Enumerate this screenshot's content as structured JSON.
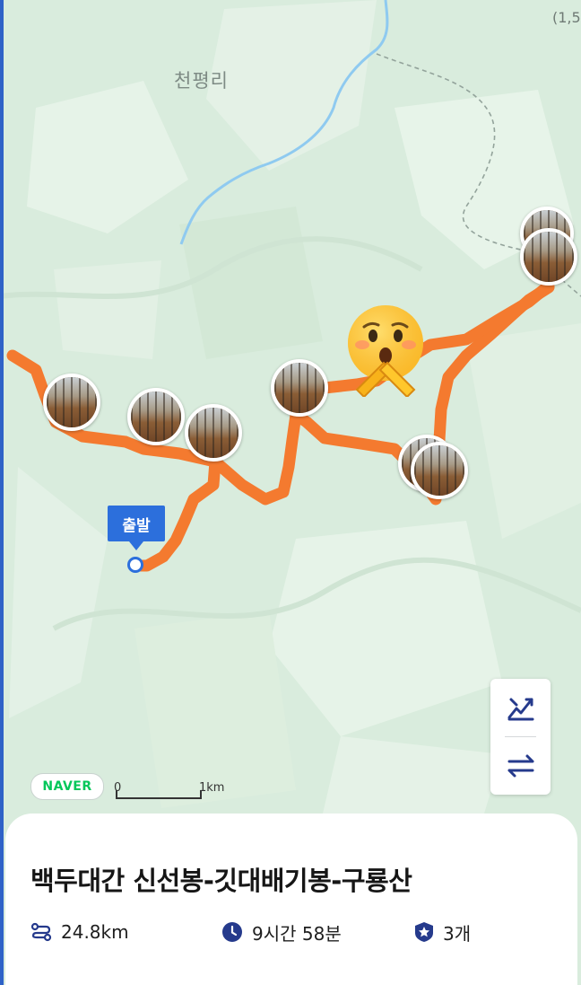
{
  "map": {
    "place_label": "천평리",
    "corner_label": "(1,5",
    "start_marker": {
      "label": "출발"
    },
    "provider_logo": "NAVER",
    "scale": {
      "zero": "0",
      "distance": "1km"
    },
    "route_color": "#f47a2f",
    "photo_markers": [
      {
        "name": "photo-marker-1"
      },
      {
        "name": "photo-marker-2"
      },
      {
        "name": "photo-marker-3"
      },
      {
        "name": "photo-marker-4"
      },
      {
        "name": "photo-marker-5"
      },
      {
        "name": "photo-marker-6"
      },
      {
        "name": "photo-marker-7"
      }
    ],
    "controls": [
      {
        "icon": "altitude-toggle-icon"
      },
      {
        "icon": "swap-direction-icon"
      }
    ]
  },
  "course": {
    "title": "백두대간 신선봉-깃대배기봉-구룡산",
    "distance": "24.8km",
    "duration": "9시간 58분",
    "badge_count": "3개"
  },
  "colors": {
    "accent_blue": "#2c6fdc",
    "icon_navy": "#253a8c",
    "naver_green": "#03c75a"
  }
}
